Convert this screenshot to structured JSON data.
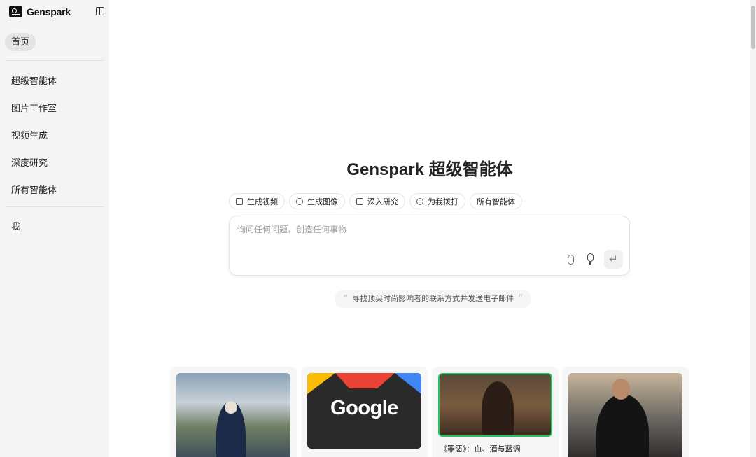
{
  "brand": {
    "name": "Genspark"
  },
  "sidebar": {
    "home": "首页",
    "items": [
      {
        "label": "超级智能体"
      },
      {
        "label": "图片工作室"
      },
      {
        "label": "视频生成"
      },
      {
        "label": "深度研究"
      },
      {
        "label": "所有智能体"
      }
    ],
    "me": "我"
  },
  "main": {
    "title": "Genspark 超级智能体",
    "chips": [
      {
        "label": "生成视频",
        "icon": "video-icon"
      },
      {
        "label": "生成图像",
        "icon": "image-icon"
      },
      {
        "label": "深入研究",
        "icon": "document-icon"
      },
      {
        "label": "为我拨打",
        "icon": "phone-icon"
      },
      {
        "label": "所有智能体",
        "icon": ""
      }
    ],
    "composer": {
      "placeholder": "询问任何问题，创造任何事物",
      "send_symbol": "↵"
    },
    "suggestion": "寻找顶尖时尚影响者的联系方式并发送电子邮件",
    "quote_open": "“",
    "quote_close": "”"
  },
  "cards": [
    {
      "caption": ""
    },
    {
      "caption": "",
      "logo_text": "Google"
    },
    {
      "caption": "《罪恶》：血、酒与蓝调"
    },
    {
      "caption": ""
    }
  ],
  "colors": {
    "sidebar_bg": "#f4f4f4",
    "text": "#232425",
    "google_red": "#ea4335",
    "google_blue": "#4285f4",
    "google_yellow": "#fbbc05",
    "google_green": "#34a853"
  }
}
